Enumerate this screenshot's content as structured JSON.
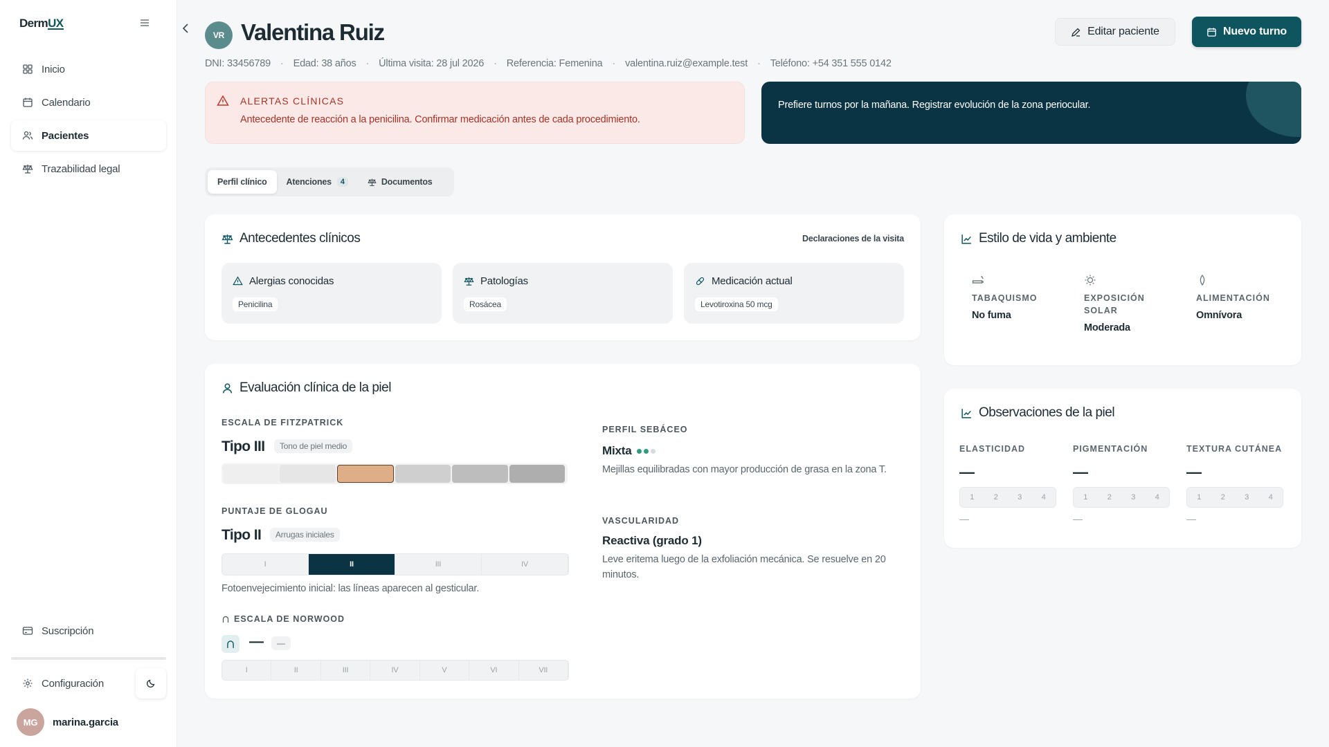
{
  "app": {
    "logo_prefix": "Derm",
    "logo_suffix": "UX"
  },
  "sidebar": {
    "items": [
      {
        "label": "Inicio",
        "icon": "grid-icon"
      },
      {
        "label": "Calendario",
        "icon": "calendar-icon"
      },
      {
        "label": "Pacientes",
        "icon": "users-icon",
        "active": true
      },
      {
        "label": "Trazabilidad legal",
        "icon": "scale-icon"
      }
    ],
    "subscription": "Suscripción",
    "settings": "Configuración",
    "user": {
      "initials": "MG",
      "name": "marina.garcia"
    }
  },
  "patient": {
    "initials": "VR",
    "name": "Valentina Ruiz",
    "meta": [
      "DNI: 33456789",
      "Edad: 38 años",
      "Última visita: 28 jul 2026",
      "Referencia: Femenina",
      "valentina.ruiz@example.test",
      "Teléfono: +54 351 555 0142"
    ]
  },
  "actions": {
    "edit": "Editar paciente",
    "new_appointment": "Nuevo turno"
  },
  "alert": {
    "title": "ALERTAS CLÍNICAS",
    "text": "Antecedente de reacción a la penicilina. Confirmar medicación antes de cada procedimiento."
  },
  "note": {
    "text": "Prefiere turnos por la mañana. Registrar evolución de la zona periocular."
  },
  "tabs": [
    {
      "label": "Perfil clínico",
      "active": true
    },
    {
      "label": "Atenciones",
      "count": "4"
    },
    {
      "label": "Documentos",
      "icon": "scale-icon"
    }
  ],
  "antecedentes": {
    "title": "Antecedentes clínicos",
    "link": "Declaraciones de la visita",
    "items": [
      {
        "label": "Alergias conocidas",
        "chip": "Penicilina",
        "icon": "warning-icon"
      },
      {
        "label": "Patologías",
        "chip": "Rosácea",
        "icon": "scale-icon"
      },
      {
        "label": "Medicación actual",
        "chip": "Levotiroxina 50 mcg",
        "icon": "pill-icon"
      }
    ]
  },
  "evaluacion": {
    "title": "Evaluación clínica de la piel",
    "fitzpatrick": {
      "label": "ESCALA DE FITZPATRICK",
      "value": "Tipo III",
      "tag": "Tono de piel medio",
      "selected_index": 2,
      "swatches": [
        "#efefef",
        "#e6e6e6",
        "#deaf86",
        "#cfcfcf",
        "#bdbdbd",
        "#aeaeae"
      ]
    },
    "glogau": {
      "label": "PUNTAJE DE GLOGAU",
      "value": "Tipo II",
      "tag": "Arrugas iniciales",
      "options": [
        "I",
        "II",
        "III",
        "IV"
      ],
      "selected_index": 1,
      "note": "Fotoenvejecimiento inicial: las líneas aparecen al gesticular."
    },
    "norwood": {
      "label": "ESCALA DE NORWOOD",
      "value": "—",
      "tag": "—",
      "options": [
        "I",
        "II",
        "III",
        "IV",
        "V",
        "VI",
        "VII"
      ]
    },
    "sebaceo": {
      "label": "PERFIL SEBÁCEO",
      "value": "Mixta",
      "level": 2,
      "max": 3,
      "text": "Mejillas equilibradas con mayor producción de grasa en la zona T."
    },
    "vascularidad": {
      "label": "VASCULARIDAD",
      "value": "Reactiva (grado 1)",
      "text": "Leve eritema luego de la exfoliación mecánica. Se resuelve en 20 minutos."
    }
  },
  "estilo": {
    "title": "Estilo de vida y ambiente",
    "items": [
      {
        "label": "TABAQUISMO",
        "value": "No fuma",
        "icon": "cigarette-icon"
      },
      {
        "label": "EXPOSICIÓN SOLAR",
        "value": "Moderada",
        "icon": "sun-icon"
      },
      {
        "label": "ALIMENTACIÓN",
        "value": "Omnívora",
        "icon": "leaf-icon"
      }
    ]
  },
  "observaciones": {
    "title": "Observaciones de la piel",
    "scale": [
      "1",
      "2",
      "3",
      "4"
    ],
    "items": [
      {
        "label": "ELASTICIDAD",
        "value": "—",
        "note": "—"
      },
      {
        "label": "PIGMENTACIÓN",
        "value": "—",
        "note": "—"
      },
      {
        "label": "TEXTURA CUTÁNEA",
        "value": "—",
        "note": "—"
      }
    ]
  },
  "colors": {
    "accent": "#0f5560",
    "dark": "#0a3344",
    "alert_bg": "#fbe9e8",
    "alert_text": "#a93226"
  }
}
